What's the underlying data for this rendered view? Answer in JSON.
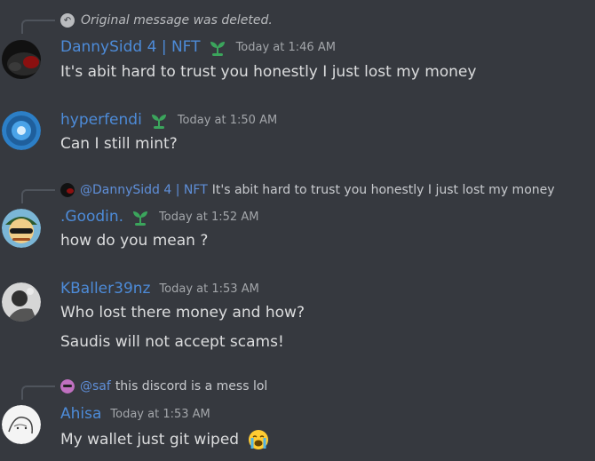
{
  "messages": [
    {
      "reply": {
        "deleted_text": "Original message was deleted."
      },
      "username": "DannySidd 4 | NFT",
      "timestamp": "Today at 1:46 AM",
      "lines": [
        "It's abit hard to trust you honestly I just lost my money"
      ],
      "name_color": "#4d8bd8"
    },
    {
      "username": "hyperfendi",
      "timestamp": "Today at 1:50 AM",
      "lines": [
        "Can I still mint?"
      ]
    },
    {
      "reply": {
        "mention": "@DannySidd 4 | NFT",
        "text": "It's abit hard to trust you honestly I just lost my money"
      },
      "username": ".Goodin.",
      "timestamp": "Today at 1:52 AM",
      "lines": [
        "how do you mean ?"
      ]
    },
    {
      "username": "KBaller39nz",
      "timestamp": "Today at 1:53 AM",
      "lines": [
        "Who lost there money and how?",
        "Saudis will not accept scams!"
      ]
    },
    {
      "reply": {
        "mention": "@saf",
        "text": "this discord is a mess lol"
      },
      "username": "Ahisa",
      "timestamp": "Today at 1:53 AM",
      "lines": [
        "My wallet just git wiped"
      ],
      "emoji": "loudly-crying-face-emoji"
    }
  ],
  "colors": {
    "background": "#36393f",
    "username": "#4d8bd8",
    "mention": "#5f8fd9",
    "message_text": "#dcddde",
    "timestamp": "#a3a6aa",
    "badge": "#3ba55c"
  },
  "icons": {
    "badge": "seedling-badge-icon",
    "deleted_reply": "reply-arrow-icon"
  }
}
